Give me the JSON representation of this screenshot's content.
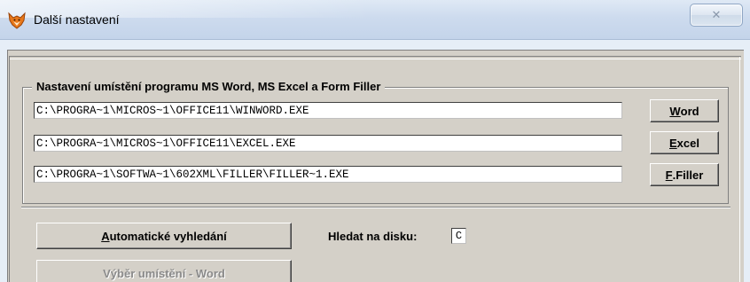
{
  "window": {
    "title": "Další nastavení",
    "close_symbol": "✕"
  },
  "group": {
    "legend": "Nastavení umístění programu MS Word, MS Excel a Form Filler"
  },
  "paths": {
    "word": "C:\\PROGRA~1\\MICROS~1\\OFFICE11\\WINWORD.EXE",
    "excel": "C:\\PROGRA~1\\MICROS~1\\OFFICE11\\EXCEL.EXE",
    "filler": "C:\\PROGRA~1\\SOFTWA~1\\602XML\\FILLER\\FILLER~1.EXE"
  },
  "buttons": {
    "word": {
      "accel": "W",
      "rest": "ord"
    },
    "excel": {
      "accel": "E",
      "rest": "xcel"
    },
    "filler": {
      "accel": "F",
      "rest": ".Filler"
    },
    "auto_search": {
      "accel": "A",
      "rest": "utomatické vyhledání"
    },
    "choose_word": "Výběr umístění - Word"
  },
  "disk": {
    "label": "Hledat na disku:",
    "value": "C"
  },
  "icons": {
    "app": "fox-app-icon",
    "close": "close-icon"
  }
}
